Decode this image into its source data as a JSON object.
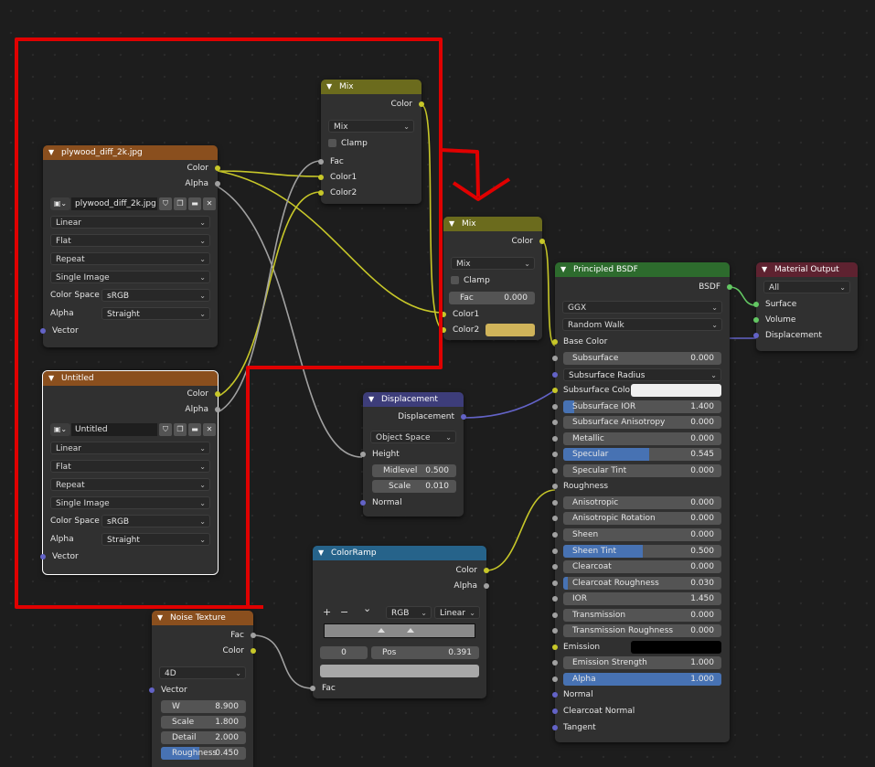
{
  "colors": {
    "accent_blue": "#4772b3",
    "annotation_red": "#e00000",
    "image_header": "#8a4f1e",
    "mix_header": "#6b6b1d",
    "displace_header": "#3d3d7a",
    "ramp_header": "#26638a",
    "bsdf_header": "#2d6b2d",
    "output_header": "#5e2230",
    "socket_color": "#c7c729",
    "socket_float": "#a1a1a1",
    "socket_vector": "#6363c7",
    "socket_shader": "#63c763"
  },
  "image1": {
    "title": "plywood_diff_2k.jpg",
    "out_color": "Color",
    "out_alpha": "Alpha",
    "image_name": "plywood_diff_2k.jpg",
    "interpolation": "Linear",
    "projection": "Flat",
    "extension": "Repeat",
    "source": "Single Image",
    "colorspace_label": "Color Space",
    "colorspace": "sRGB",
    "alpha_label": "Alpha",
    "alpha": "Straight",
    "in_vector": "Vector"
  },
  "image2": {
    "title": "Untitled",
    "out_color": "Color",
    "out_alpha": "Alpha",
    "image_name": "Untitled",
    "interpolation": "Linear",
    "projection": "Flat",
    "extension": "Repeat",
    "source": "Single Image",
    "colorspace_label": "Color Space",
    "colorspace": "sRGB",
    "alpha_label": "Alpha",
    "alpha": "Straight",
    "in_vector": "Vector"
  },
  "mix1": {
    "title": "Mix",
    "out_color": "Color",
    "blend": "Mix",
    "clamp": "Clamp",
    "fac": "Fac",
    "color1": "Color1",
    "color2": "Color2"
  },
  "mix2": {
    "title": "Mix",
    "out_color": "Color",
    "blend": "Mix",
    "clamp": "Clamp",
    "fac_label": "Fac",
    "fac_value": "0.000",
    "color1": "Color1",
    "color2": "Color2",
    "color2_swatch": "#d0b45a"
  },
  "displacement": {
    "title": "Displacement",
    "out": "Displacement",
    "space": "Object Space",
    "height": "Height",
    "midlevel_label": "Midlevel",
    "midlevel": "0.500",
    "scale_label": "Scale",
    "scale": "0.010",
    "normal": "Normal"
  },
  "colorramp": {
    "title": "ColorRamp",
    "out_color": "Color",
    "out_alpha": "Alpha",
    "plus": "+",
    "minus": "−",
    "chev": "⌄",
    "mode": "RGB",
    "interp": "Linear",
    "index": "0",
    "pos_label": "Pos",
    "pos": "0.391",
    "in_fac": "Fac"
  },
  "noise": {
    "title": "Noise Texture",
    "out_fac": "Fac",
    "out_color": "Color",
    "dims": "4D",
    "in_vector": "Vector",
    "w_label": "W",
    "w": "8.900",
    "scale_label": "Scale",
    "scale": "1.800",
    "detail_label": "Detail",
    "detail": "2.000",
    "roughness_label": "Roughness",
    "roughness": "0.450",
    "roughness_frac": 0.45
  },
  "bsdf": {
    "title": "Principled BSDF",
    "out": "BSDF",
    "distribution": "GGX",
    "sss_method": "Random Walk",
    "base_color": "Base Color",
    "subsurface_label": "Subsurface",
    "subsurface": "0.000",
    "subsurface_radius": "Subsurface Radius",
    "subsurface_color": "Subsurface Colo",
    "subsurface_color_swatch": "#f0f0f0",
    "subsurface_ior_label": "Subsurface IOR",
    "subsurface_ior": "1.400",
    "subsurface_aniso_label": "Subsurface Anisotropy",
    "subsurface_aniso": "0.000",
    "metallic_label": "Metallic",
    "metallic": "0.000",
    "specular_label": "Specular",
    "specular": "0.545",
    "specular_frac": 0.545,
    "specular_tint_label": "Specular Tint",
    "specular_tint": "0.000",
    "roughness": "Roughness",
    "anisotropic_label": "Anisotropic",
    "anisotropic": "0.000",
    "aniso_rot_label": "Anisotropic Rotation",
    "aniso_rot": "0.000",
    "sheen_label": "Sheen",
    "sheen": "0.000",
    "sheen_tint_label": "Sheen Tint",
    "sheen_tint": "0.500",
    "sheen_tint_frac": 0.5,
    "clearcoat_label": "Clearcoat",
    "clearcoat": "0.000",
    "clearcoat_rough_label": "Clearcoat Roughness",
    "clearcoat_rough": "0.030",
    "clearcoat_rough_frac": 0.03,
    "ior_label": "IOR",
    "ior": "1.450",
    "transmission_label": "Transmission",
    "transmission": "0.000",
    "trans_rough_label": "Transmission Roughness",
    "trans_rough": "0.000",
    "emission": "Emission",
    "emission_swatch": "#000000",
    "emission_strength_label": "Emission Strength",
    "emission_strength": "1.000",
    "alpha_label": "Alpha",
    "alpha": "1.000",
    "alpha_frac": 1.0,
    "normal": "Normal",
    "clearcoat_normal": "Clearcoat Normal",
    "tangent": "Tangent"
  },
  "output": {
    "title": "Material Output",
    "target": "All",
    "surface": "Surface",
    "volume": "Volume",
    "displacement": "Displacement"
  }
}
